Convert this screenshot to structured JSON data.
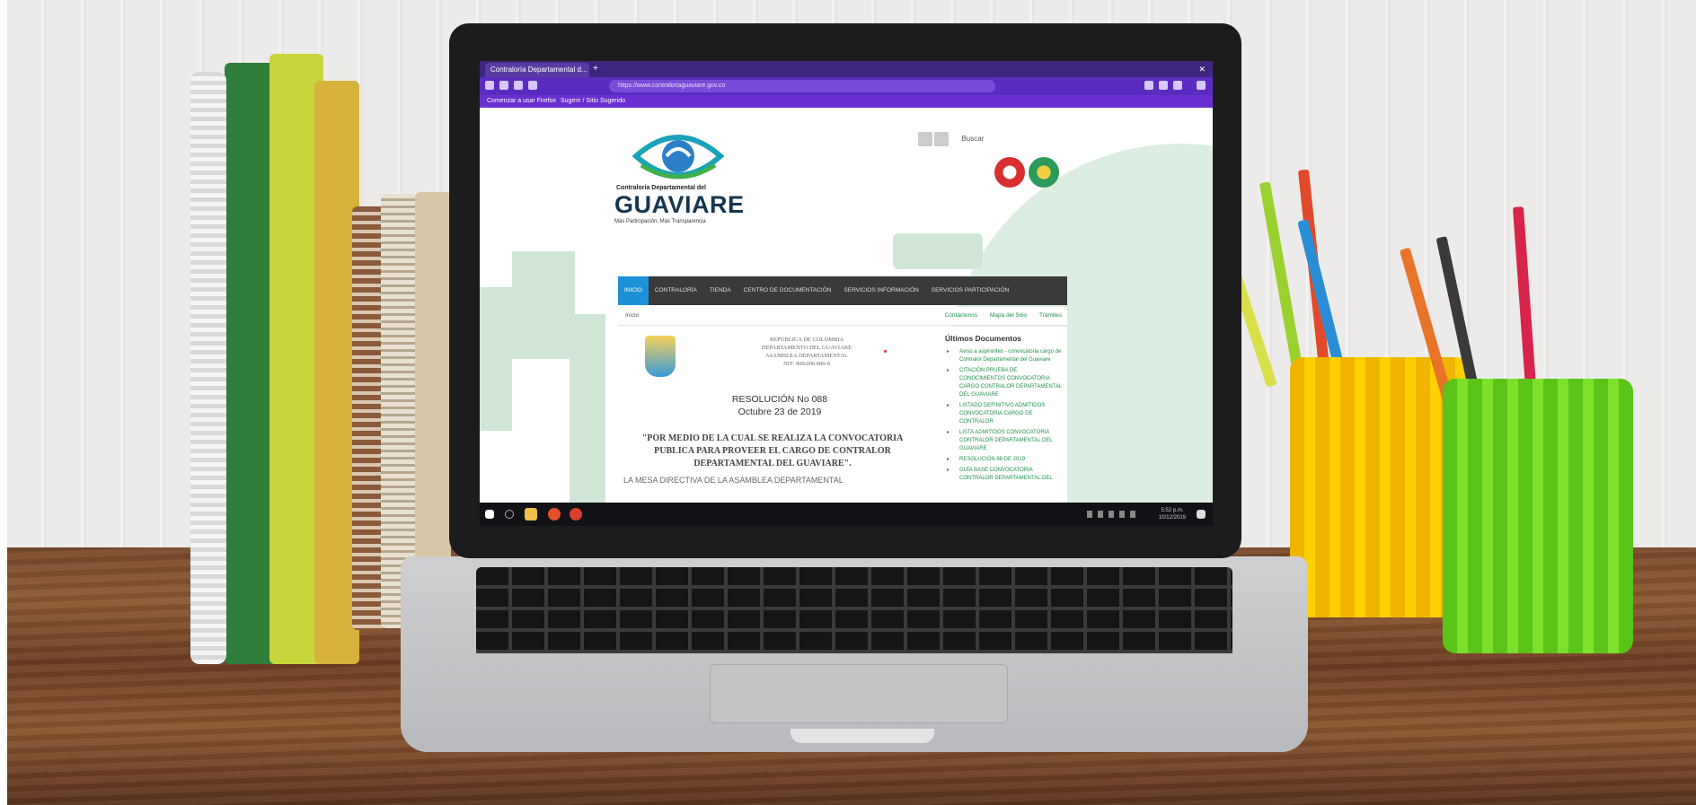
{
  "browser": {
    "tab_title": "Contraloría Departamental d...",
    "url": "https://www.contraloriaguaviare.gov.co",
    "bookmarks": [
      "Comenzar a usar Firefox",
      "Sugerir / Sitio Sugerido"
    ]
  },
  "site": {
    "search_placeholder": "Buscar",
    "logo_small": "Contraloría Departamental del",
    "logo_big": "GUAVIARE",
    "logo_tagline": "Más Participación, Más Transparencia",
    "nav": [
      "INICIO",
      "CONTRALORÍA",
      "TIENDA",
      "CENTRO DE DOCUMENTACIÓN",
      "SERVICIOS INFORMACIÓN",
      "SERVICIOS PARTICIPACIÓN"
    ],
    "breadcrumb": "Inicio",
    "utility_links": [
      "Contáctenos",
      "Mapa del Sitio",
      "Trámites"
    ]
  },
  "document": {
    "header_lines": [
      "REPÚBLICA DE COLOMBIA",
      "DEPARTAMENTO DEL GUAVIARE",
      "ASAMBLEA DEPARTAMENTAL",
      "NIT: 800.000.000-0"
    ],
    "resolution_no": "RESOLUCIÓN No 088",
    "resolution_date": "Octubre 23 de 2019",
    "resolution_body": "\"POR MEDIO DE LA CUAL SE REALIZA LA CONVOCATORIA PUBLICA PARA PROVEER EL CARGO DE CONTRALOR DEPARTAMENTAL DEL GUAVIARE\".",
    "resolution_tail": "LA MESA DIRECTIVA DE LA ASAMBLEA DEPARTAMENTAL"
  },
  "sidebar": {
    "title": "Últimos Documentos",
    "items": [
      "Aviso a aspirantes - convocatoria cargo de Contralor Departamental del Guaviare",
      "CITACIÓN PRUEBA DE CONOCIMIENTOS CONVOCATORIA CARGO CONTRALOR DEPARTAMENTAL DEL GUAVIARE",
      "LISTADO DEFINITIVO ADMITIDOS CONVOCATORIA CARGO DE CONTRALOR",
      "LISTA ADMITIDOS CONVOCATORIA CONTRALOR DEPARTAMENTAL DEL GUAVIARE",
      "RESOLUCIÓN 88 DE 2019",
      "GUÍA BASE CONVOCATORIA CONTRALOR DEPARTAMENTAL DEL"
    ]
  },
  "taskbar": {
    "time": "5:52 p.m.",
    "date": "10/12/2019"
  },
  "colors": {
    "nav_active": "#1e90d8",
    "browser_purple": "#5b2bc0",
    "link_green": "#1f8f4a"
  }
}
